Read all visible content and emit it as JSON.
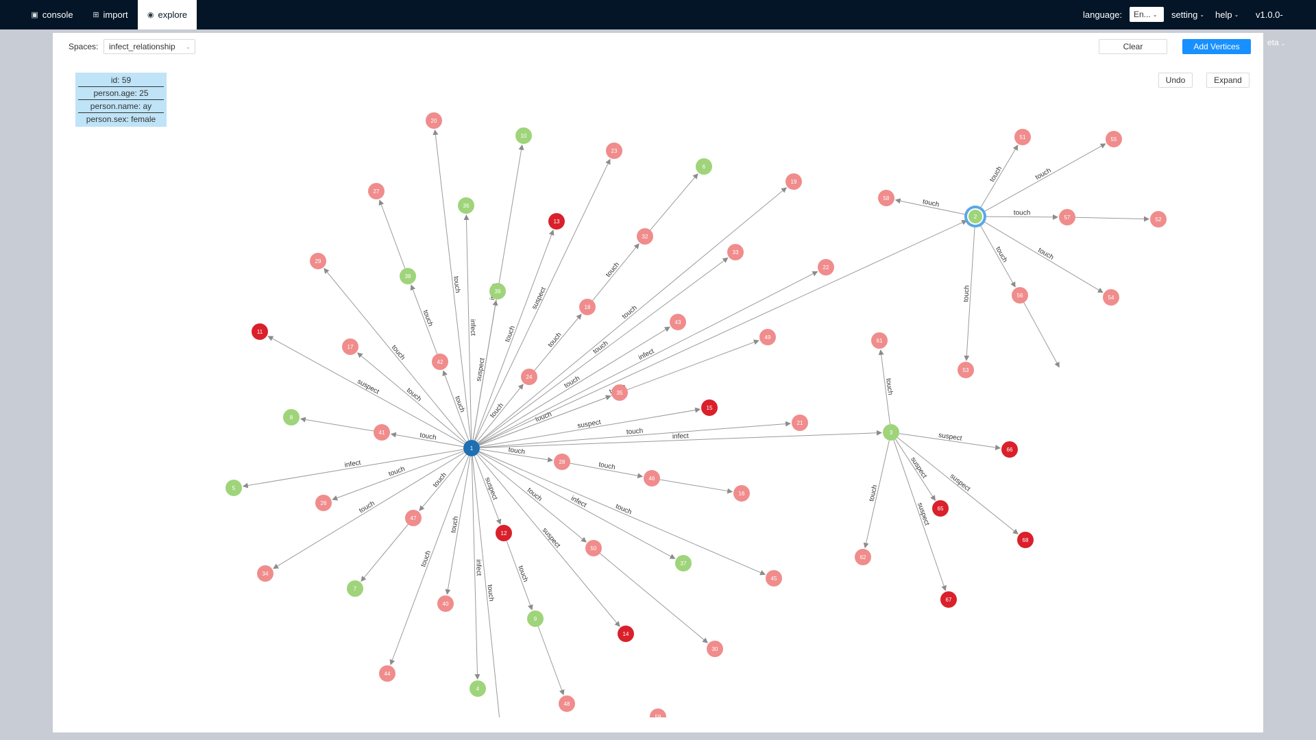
{
  "nav": {
    "tabs": [
      {
        "label": "console",
        "icon": "console-icon",
        "active": false
      },
      {
        "label": "import",
        "icon": "import-icon",
        "active": false
      },
      {
        "label": "explore",
        "icon": "eye-icon",
        "active": true
      }
    ],
    "language_label": "language:",
    "language_value": "En...",
    "setting_label": "setting",
    "help_label": "help",
    "version": "v1.0.0-",
    "peek_text": "eta"
  },
  "toolbar": {
    "spaces_label": "Spaces:",
    "spaces_value": "infect_relationship",
    "clear_label": "Clear",
    "add_vertices_label": "Add Vertices",
    "undo_label": "Undo",
    "expand_label": "Expand"
  },
  "tooltip": {
    "lines": [
      "id: 59",
      "person.age: 25",
      "person.name: ay",
      "person.sex: female"
    ]
  },
  "colors": {
    "nav_bg": "#041527",
    "accent": "#1890ff",
    "node_pink": "#f08c8c",
    "node_red": "#d9202b",
    "node_green": "#9fd47a",
    "node_blue": "#1f6fb2",
    "node_highlight_ring": "#5aa7e6",
    "edge": "#999999"
  },
  "graph": {
    "nodes": [
      {
        "id": "1",
        "color": "blue"
      },
      {
        "id": "2",
        "color": "green",
        "selected": true
      },
      {
        "id": "3",
        "color": "green"
      },
      {
        "id": "4",
        "color": "green"
      },
      {
        "id": "5",
        "color": "green"
      },
      {
        "id": "6",
        "color": "green"
      },
      {
        "id": "7",
        "color": "green"
      },
      {
        "id": "8",
        "color": "green"
      },
      {
        "id": "9",
        "color": "green"
      },
      {
        "id": "10",
        "color": "green"
      },
      {
        "id": "11",
        "color": "red"
      },
      {
        "id": "12",
        "color": "red"
      },
      {
        "id": "13",
        "color": "red"
      },
      {
        "id": "14",
        "color": "red"
      },
      {
        "id": "15",
        "color": "red"
      },
      {
        "id": "16",
        "color": "pink"
      },
      {
        "id": "17",
        "color": "pink"
      },
      {
        "id": "18",
        "color": "pink"
      },
      {
        "id": "19",
        "color": "pink"
      },
      {
        "id": "20",
        "color": "pink"
      },
      {
        "id": "21",
        "color": "pink"
      },
      {
        "id": "22",
        "color": "pink"
      },
      {
        "id": "23",
        "color": "pink"
      },
      {
        "id": "24",
        "color": "pink"
      },
      {
        "id": "26",
        "color": "pink"
      },
      {
        "id": "27",
        "color": "pink"
      },
      {
        "id": "28",
        "color": "pink"
      },
      {
        "id": "29",
        "color": "pink"
      },
      {
        "id": "30",
        "color": "pink"
      },
      {
        "id": "32",
        "color": "pink"
      },
      {
        "id": "33",
        "color": "pink"
      },
      {
        "id": "34",
        "color": "pink"
      },
      {
        "id": "35",
        "color": "pink"
      },
      {
        "id": "36",
        "color": "green"
      },
      {
        "id": "37",
        "color": "green"
      },
      {
        "id": "38",
        "color": "green"
      },
      {
        "id": "39",
        "color": "green"
      },
      {
        "id": "40",
        "color": "pink"
      },
      {
        "id": "41",
        "color": "pink"
      },
      {
        "id": "42",
        "color": "pink"
      },
      {
        "id": "43",
        "color": "pink"
      },
      {
        "id": "44",
        "color": "pink"
      },
      {
        "id": "45",
        "color": "pink"
      },
      {
        "id": "46",
        "color": "pink"
      },
      {
        "id": "47",
        "color": "pink"
      },
      {
        "id": "48",
        "color": "pink"
      },
      {
        "id": "49",
        "color": "pink"
      },
      {
        "id": "50",
        "color": "pink"
      },
      {
        "id": "51",
        "color": "pink"
      },
      {
        "id": "52",
        "color": "pink"
      },
      {
        "id": "53",
        "color": "pink"
      },
      {
        "id": "54",
        "color": "pink"
      },
      {
        "id": "55",
        "color": "pink"
      },
      {
        "id": "56",
        "color": "pink"
      },
      {
        "id": "57",
        "color": "pink"
      },
      {
        "id": "58",
        "color": "pink"
      },
      {
        "id": "59",
        "color": "pink"
      },
      {
        "id": "61",
        "color": "pink"
      },
      {
        "id": "62",
        "color": "pink"
      },
      {
        "id": "65",
        "color": "red"
      },
      {
        "id": "66",
        "color": "red"
      },
      {
        "id": "67",
        "color": "red"
      },
      {
        "id": "68",
        "color": "red"
      }
    ],
    "edges": [
      {
        "from": "1",
        "to": "20",
        "label": "touch"
      },
      {
        "from": "1",
        "to": "36",
        "label": "infect"
      },
      {
        "from": "1",
        "to": "10",
        "label": "infect"
      },
      {
        "from": "1",
        "to": "13",
        "label": "touch"
      },
      {
        "from": "1",
        "to": "23",
        "label": "suspect"
      },
      {
        "from": "1",
        "to": "24",
        "label": "touch"
      },
      {
        "from": "24",
        "to": "18",
        "label": "touch"
      },
      {
        "from": "18",
        "to": "32",
        "label": "touch"
      },
      {
        "from": "32",
        "to": "6",
        "label": ""
      },
      {
        "from": "1",
        "to": "19",
        "label": "touch"
      },
      {
        "from": "1",
        "to": "33",
        "label": "touch"
      },
      {
        "from": "1",
        "to": "43",
        "label": "touch"
      },
      {
        "from": "1",
        "to": "22",
        "label": "infect"
      },
      {
        "from": "1",
        "to": "49",
        "label": "touch"
      },
      {
        "from": "1",
        "to": "35",
        "label": "touch"
      },
      {
        "from": "1",
        "to": "2",
        "label": ""
      },
      {
        "from": "1",
        "to": "15",
        "label": "suspect"
      },
      {
        "from": "1",
        "to": "21",
        "label": "touch"
      },
      {
        "from": "1",
        "to": "3",
        "label": "infect"
      },
      {
        "from": "1",
        "to": "28",
        "label": "touch"
      },
      {
        "from": "28",
        "to": "46",
        "label": "touch"
      },
      {
        "from": "46",
        "to": "16",
        "label": ""
      },
      {
        "from": "1",
        "to": "45",
        "label": "touch"
      },
      {
        "from": "1",
        "to": "37",
        "label": "infect"
      },
      {
        "from": "1",
        "to": "50",
        "label": "touch"
      },
      {
        "from": "50",
        "to": "30",
        "label": ""
      },
      {
        "from": "1",
        "to": "14",
        "label": "suspect"
      },
      {
        "from": "1",
        "to": "12",
        "label": "suspect"
      },
      {
        "from": "12",
        "to": "9",
        "label": "touch"
      },
      {
        "from": "9",
        "to": "48",
        "label": ""
      },
      {
        "from": "1",
        "to": "59",
        "label": "touch"
      },
      {
        "from": "1",
        "to": "4",
        "label": "infect"
      },
      {
        "from": "1",
        "to": "40",
        "label": "touch"
      },
      {
        "from": "1",
        "to": "44",
        "label": "touch"
      },
      {
        "from": "1",
        "to": "47",
        "label": "touch"
      },
      {
        "from": "47",
        "to": "7",
        "label": ""
      },
      {
        "from": "1",
        "to": "34",
        "label": "touch"
      },
      {
        "from": "1",
        "to": "26",
        "label": "touch"
      },
      {
        "from": "1",
        "to": "5",
        "label": "infect"
      },
      {
        "from": "1",
        "to": "41",
        "label": "touch"
      },
      {
        "from": "41",
        "to": "8",
        "label": ""
      },
      {
        "from": "1",
        "to": "11",
        "label": "suspect"
      },
      {
        "from": "1",
        "to": "17",
        "label": "touch"
      },
      {
        "from": "1",
        "to": "29",
        "label": "touch"
      },
      {
        "from": "1",
        "to": "42",
        "label": "touch"
      },
      {
        "from": "42",
        "to": "38",
        "label": "touch"
      },
      {
        "from": "38",
        "to": "27",
        "label": ""
      },
      {
        "from": "1",
        "to": "39",
        "label": "suspect"
      },
      {
        "from": "2",
        "to": "58",
        "label": "touch"
      },
      {
        "from": "2",
        "to": "51",
        "label": "touch"
      },
      {
        "from": "2",
        "to": "55",
        "label": "touch"
      },
      {
        "from": "2",
        "to": "57",
        "label": "touch"
      },
      {
        "from": "57",
        "to": "52",
        "label": ""
      },
      {
        "from": "2",
        "to": "54",
        "label": "touch"
      },
      {
        "from": "2",
        "to": "56",
        "label": "touch"
      },
      {
        "from": "56",
        "to": "60",
        "label": ""
      },
      {
        "from": "2",
        "to": "53",
        "label": "touch"
      },
      {
        "from": "3",
        "to": "61",
        "label": "touch"
      },
      {
        "from": "3",
        "to": "66",
        "label": "suspect"
      },
      {
        "from": "3",
        "to": "65",
        "label": "suspect"
      },
      {
        "from": "3",
        "to": "68",
        "label": "suspect"
      },
      {
        "from": "3",
        "to": "67",
        "label": "suspect"
      },
      {
        "from": "3",
        "to": "62",
        "label": "touch"
      }
    ]
  }
}
